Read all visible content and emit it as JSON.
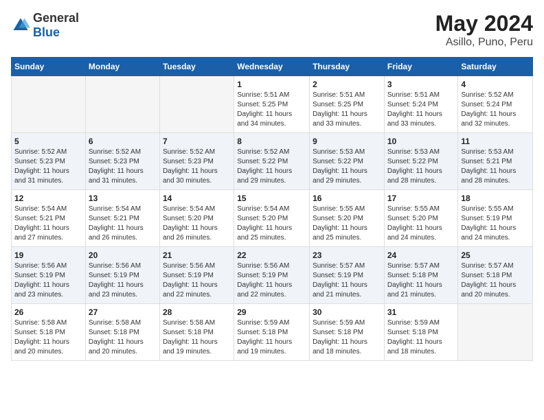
{
  "header": {
    "logo_general": "General",
    "logo_blue": "Blue",
    "title": "May 2024",
    "subtitle": "Asillo, Puno, Peru"
  },
  "calendar": {
    "weekdays": [
      "Sunday",
      "Monday",
      "Tuesday",
      "Wednesday",
      "Thursday",
      "Friday",
      "Saturday"
    ],
    "weeks": [
      [
        {
          "day": "",
          "info": ""
        },
        {
          "day": "",
          "info": ""
        },
        {
          "day": "",
          "info": ""
        },
        {
          "day": "1",
          "info": "Sunrise: 5:51 AM\nSunset: 5:25 PM\nDaylight: 11 hours\nand 34 minutes."
        },
        {
          "day": "2",
          "info": "Sunrise: 5:51 AM\nSunset: 5:25 PM\nDaylight: 11 hours\nand 33 minutes."
        },
        {
          "day": "3",
          "info": "Sunrise: 5:51 AM\nSunset: 5:24 PM\nDaylight: 11 hours\nand 33 minutes."
        },
        {
          "day": "4",
          "info": "Sunrise: 5:52 AM\nSunset: 5:24 PM\nDaylight: 11 hours\nand 32 minutes."
        }
      ],
      [
        {
          "day": "5",
          "info": "Sunrise: 5:52 AM\nSunset: 5:23 PM\nDaylight: 11 hours\nand 31 minutes."
        },
        {
          "day": "6",
          "info": "Sunrise: 5:52 AM\nSunset: 5:23 PM\nDaylight: 11 hours\nand 31 minutes."
        },
        {
          "day": "7",
          "info": "Sunrise: 5:52 AM\nSunset: 5:23 PM\nDaylight: 11 hours\nand 30 minutes."
        },
        {
          "day": "8",
          "info": "Sunrise: 5:52 AM\nSunset: 5:22 PM\nDaylight: 11 hours\nand 29 minutes."
        },
        {
          "day": "9",
          "info": "Sunrise: 5:53 AM\nSunset: 5:22 PM\nDaylight: 11 hours\nand 29 minutes."
        },
        {
          "day": "10",
          "info": "Sunrise: 5:53 AM\nSunset: 5:22 PM\nDaylight: 11 hours\nand 28 minutes."
        },
        {
          "day": "11",
          "info": "Sunrise: 5:53 AM\nSunset: 5:21 PM\nDaylight: 11 hours\nand 28 minutes."
        }
      ],
      [
        {
          "day": "12",
          "info": "Sunrise: 5:54 AM\nSunset: 5:21 PM\nDaylight: 11 hours\nand 27 minutes."
        },
        {
          "day": "13",
          "info": "Sunrise: 5:54 AM\nSunset: 5:21 PM\nDaylight: 11 hours\nand 26 minutes."
        },
        {
          "day": "14",
          "info": "Sunrise: 5:54 AM\nSunset: 5:20 PM\nDaylight: 11 hours\nand 26 minutes."
        },
        {
          "day": "15",
          "info": "Sunrise: 5:54 AM\nSunset: 5:20 PM\nDaylight: 11 hours\nand 25 minutes."
        },
        {
          "day": "16",
          "info": "Sunrise: 5:55 AM\nSunset: 5:20 PM\nDaylight: 11 hours\nand 25 minutes."
        },
        {
          "day": "17",
          "info": "Sunrise: 5:55 AM\nSunset: 5:20 PM\nDaylight: 11 hours\nand 24 minutes."
        },
        {
          "day": "18",
          "info": "Sunrise: 5:55 AM\nSunset: 5:19 PM\nDaylight: 11 hours\nand 24 minutes."
        }
      ],
      [
        {
          "day": "19",
          "info": "Sunrise: 5:56 AM\nSunset: 5:19 PM\nDaylight: 11 hours\nand 23 minutes."
        },
        {
          "day": "20",
          "info": "Sunrise: 5:56 AM\nSunset: 5:19 PM\nDaylight: 11 hours\nand 23 minutes."
        },
        {
          "day": "21",
          "info": "Sunrise: 5:56 AM\nSunset: 5:19 PM\nDaylight: 11 hours\nand 22 minutes."
        },
        {
          "day": "22",
          "info": "Sunrise: 5:56 AM\nSunset: 5:19 PM\nDaylight: 11 hours\nand 22 minutes."
        },
        {
          "day": "23",
          "info": "Sunrise: 5:57 AM\nSunset: 5:19 PM\nDaylight: 11 hours\nand 21 minutes."
        },
        {
          "day": "24",
          "info": "Sunrise: 5:57 AM\nSunset: 5:18 PM\nDaylight: 11 hours\nand 21 minutes."
        },
        {
          "day": "25",
          "info": "Sunrise: 5:57 AM\nSunset: 5:18 PM\nDaylight: 11 hours\nand 20 minutes."
        }
      ],
      [
        {
          "day": "26",
          "info": "Sunrise: 5:58 AM\nSunset: 5:18 PM\nDaylight: 11 hours\nand 20 minutes."
        },
        {
          "day": "27",
          "info": "Sunrise: 5:58 AM\nSunset: 5:18 PM\nDaylight: 11 hours\nand 20 minutes."
        },
        {
          "day": "28",
          "info": "Sunrise: 5:58 AM\nSunset: 5:18 PM\nDaylight: 11 hours\nand 19 minutes."
        },
        {
          "day": "29",
          "info": "Sunrise: 5:59 AM\nSunset: 5:18 PM\nDaylight: 11 hours\nand 19 minutes."
        },
        {
          "day": "30",
          "info": "Sunrise: 5:59 AM\nSunset: 5:18 PM\nDaylight: 11 hours\nand 18 minutes."
        },
        {
          "day": "31",
          "info": "Sunrise: 5:59 AM\nSunset: 5:18 PM\nDaylight: 11 hours\nand 18 minutes."
        },
        {
          "day": "",
          "info": ""
        }
      ]
    ]
  }
}
